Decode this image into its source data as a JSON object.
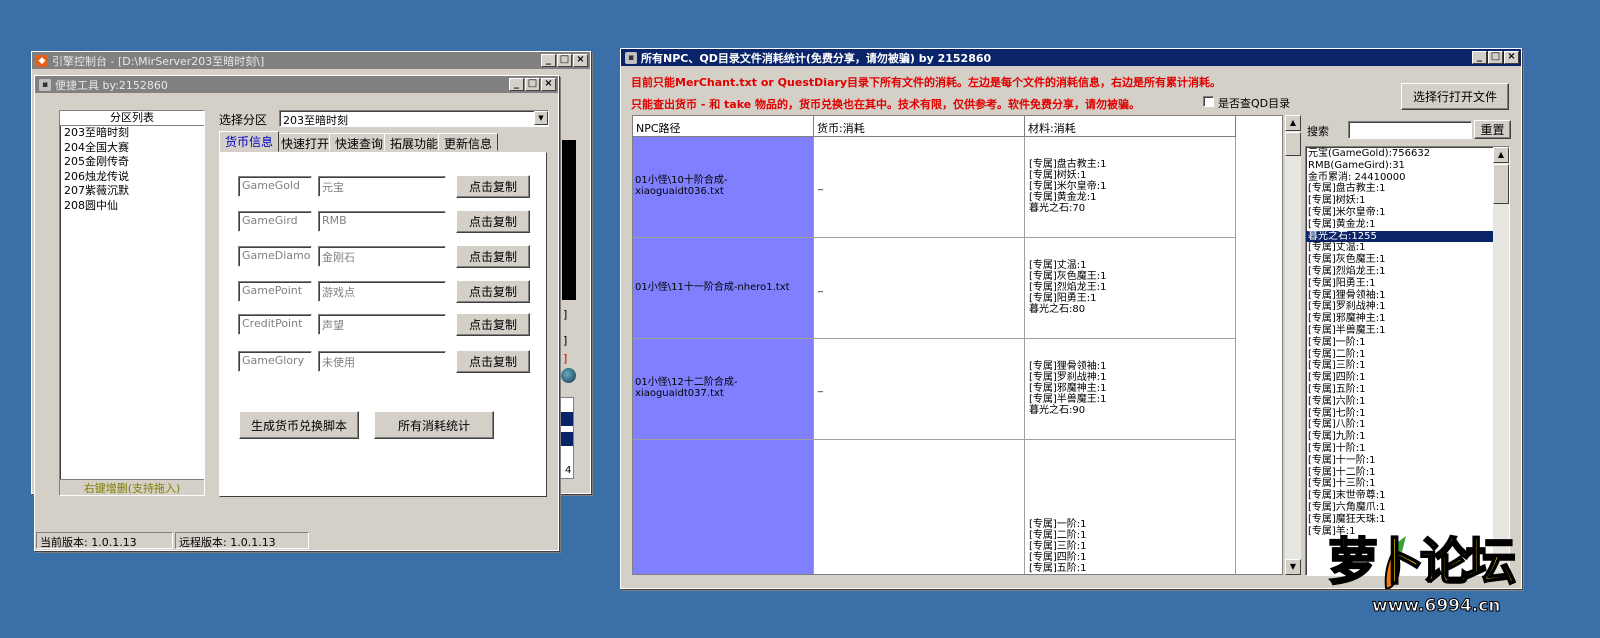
{
  "engine_window": {
    "title": "引擎控制台 - [D:\\MirServer203至暗时刻\\]",
    "bg_fragments": [
      "]",
      "]",
      "]",
      "4"
    ]
  },
  "tools_window": {
    "title": "便捷工具   by:2152860",
    "partition_list": {
      "header": "分区列表",
      "items": [
        "203至暗时刻",
        "204全国大赛",
        "205金刚传奇",
        "206烛龙传说",
        "207紫薇沉默",
        "208圆中仙"
      ],
      "footer": "右键增删(支持拖入)"
    },
    "select_label": "选择分区",
    "select_value": "203至暗时刻",
    "tabs": [
      "货币信息",
      "快速打开",
      "快速查询",
      "拓展功能",
      "更新信息"
    ],
    "currency_rows": [
      {
        "code": "GameGold",
        "name": "元宝",
        "button": "点击复制"
      },
      {
        "code": "GameGird",
        "name": "RMB",
        "button": "点击复制"
      },
      {
        "code": "GameDiamond",
        "name": "金刚石",
        "button": "点击复制"
      },
      {
        "code": "GamePoint",
        "name": "游戏点",
        "button": "点击复制"
      },
      {
        "code": "CreditPoint",
        "name": "声望",
        "button": "点击复制"
      },
      {
        "code": "GameGlory",
        "name": "未使用",
        "button": "点击复制"
      }
    ],
    "gen_button": "生成货币兑换脚本",
    "stats_button": "所有消耗统计",
    "status_current": "当前版本: 1.0.1.13",
    "status_remote": "远程版本: 1.0.1.13"
  },
  "stats_window": {
    "title": "所有NPC、QD目录文件消耗统计(免费分享，请勿被骗)      by 2152860",
    "note_line1": "目前只能MerChant.txt or QuestDiary目录下所有文件的消耗。左边是每个文件的消耗信息，右边是所有累计消耗。",
    "note_line2": "只能查出货币 - 和 take 物品的，货币兑换也在其中。技术有限，仅供参考。软件免费分享，请勿被骗。",
    "checkbox_label": "是否查QD目录",
    "open_button": "选择行打开文件",
    "columns": [
      "NPC路径",
      "货币:消耗",
      "材料:消耗"
    ],
    "rows": [
      {
        "path": "01小怪\\10十阶合成-xiaoguaidt036.txt",
        "currency": "_",
        "materials": [
          "[专属]盘古教主:1",
          "[专属]树妖:1",
          "[专属]米尔皇帝:1",
          "[专属]黄金龙:1",
          "暮光之石:70"
        ]
      },
      {
        "path": "01小怪\\11十一阶合成-nhero1.txt",
        "currency": "_",
        "materials": [
          "[专属]丈温:1",
          "[专属]灰色魔王:1",
          "[专属]烈焰龙王:1",
          "[专属]阳勇王:1",
          "暮光之石:80"
        ]
      },
      {
        "path": "01小怪\\12十二阶合成-xiaoguaidt037.txt",
        "currency": "_",
        "materials": [
          "[专属]狸骨领袖:1",
          "[专属]罗刹战神:1",
          "[专属]邪魔神主:1",
          "[专属]半兽魔王:1",
          "暮光之石:90"
        ]
      },
      {
        "path": "",
        "currency": "",
        "materials": [
          "[专属]一阶:1",
          "[专属]二阶:1",
          "[专属]三阶:1",
          "[专属]四阶:1",
          "[专属]五阶:1"
        ]
      }
    ],
    "search_label": "搜索",
    "reset_button": "重置",
    "summary": [
      "元宝(GameGold):756632",
      "RMB(GameGird):31",
      "金币累消: 24410000",
      "[专属]盘古教主:1",
      "[专属]树妖:1",
      "[专属]米尔皇帝:1",
      "[专属]黄金龙:1",
      "暮光之石:1255",
      "[专属]丈温:1",
      "[专属]灰色魔王:1",
      "[专属]烈焰龙王:1",
      "[专属]阳勇王:1",
      "[专属]狸骨领袖:1",
      "[专属]罗刹战神:1",
      "[专属]邪魔神主:1",
      "[专属]半兽魔王:1",
      "[专属]一阶:1",
      "[专属]二阶:1",
      "[专属]三阶:1",
      "[专属]四阶:1",
      "[专属]五阶:1",
      "[专属]六阶:1",
      "[专属]七阶:1",
      "[专属]八阶:1",
      "[专属]九阶:1",
      "[专属]十阶:1",
      "[专属]十一阶:1",
      "[专属]十二阶:1",
      "[专属]十三阶:1",
      "[专属]末世帝尊:1",
      "[专属]六角魔爪:1",
      "[专属]魔狂天珠:1",
      "[专属]羊:1"
    ],
    "highlight_index": 7
  },
  "watermark": {
    "logo": "萝卜论坛",
    "url": "www.6994.cn"
  },
  "colors": {
    "desktop": "#3a6fa8",
    "path_cell": "#8080ff",
    "note_red": "#e00000",
    "highlight": "#0a246a"
  }
}
